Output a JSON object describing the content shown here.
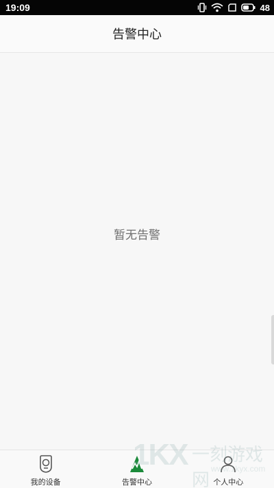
{
  "status_bar": {
    "time": "19:09",
    "battery": "48"
  },
  "header": {
    "title": "告警中心"
  },
  "main": {
    "empty_message": "暂无告警"
  },
  "tabbar": {
    "tabs": [
      {
        "label": "我的设备",
        "icon": "device-icon"
      },
      {
        "label": "告警中心",
        "icon": "alarm-icon",
        "active": true
      },
      {
        "label": "个人中心",
        "icon": "person-icon"
      }
    ]
  },
  "watermark": {
    "logo": "1KX",
    "title": "一刻游戏网",
    "url": "www.1kyx.com"
  },
  "colors": {
    "status_bg": "#050505",
    "accent_green": "#1b8a3a",
    "page_bg": "#f7f7f7"
  }
}
